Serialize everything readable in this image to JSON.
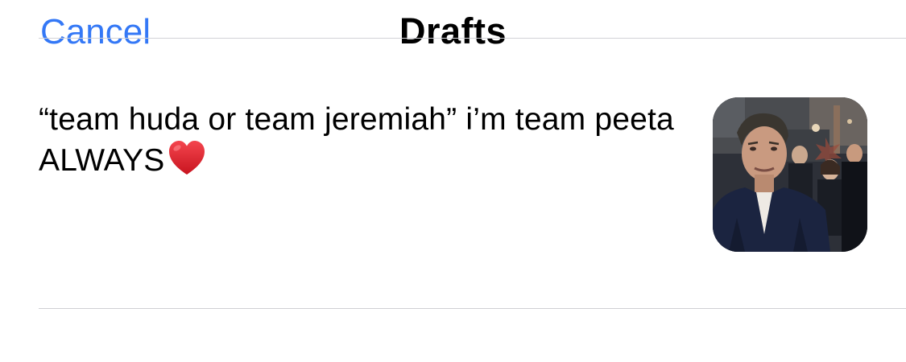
{
  "header": {
    "cancel_label": "Cancel",
    "title": "Drafts"
  },
  "drafts": [
    {
      "text": "“team huda or team jeremiah” i’m team peeta ALWAYS",
      "emoji": "❤️",
      "has_media_thumbnail": true
    }
  ],
  "colors": {
    "accent": "#3478f6",
    "text": "#000000",
    "divider": "#d1d1d6",
    "background": "#ffffff"
  }
}
